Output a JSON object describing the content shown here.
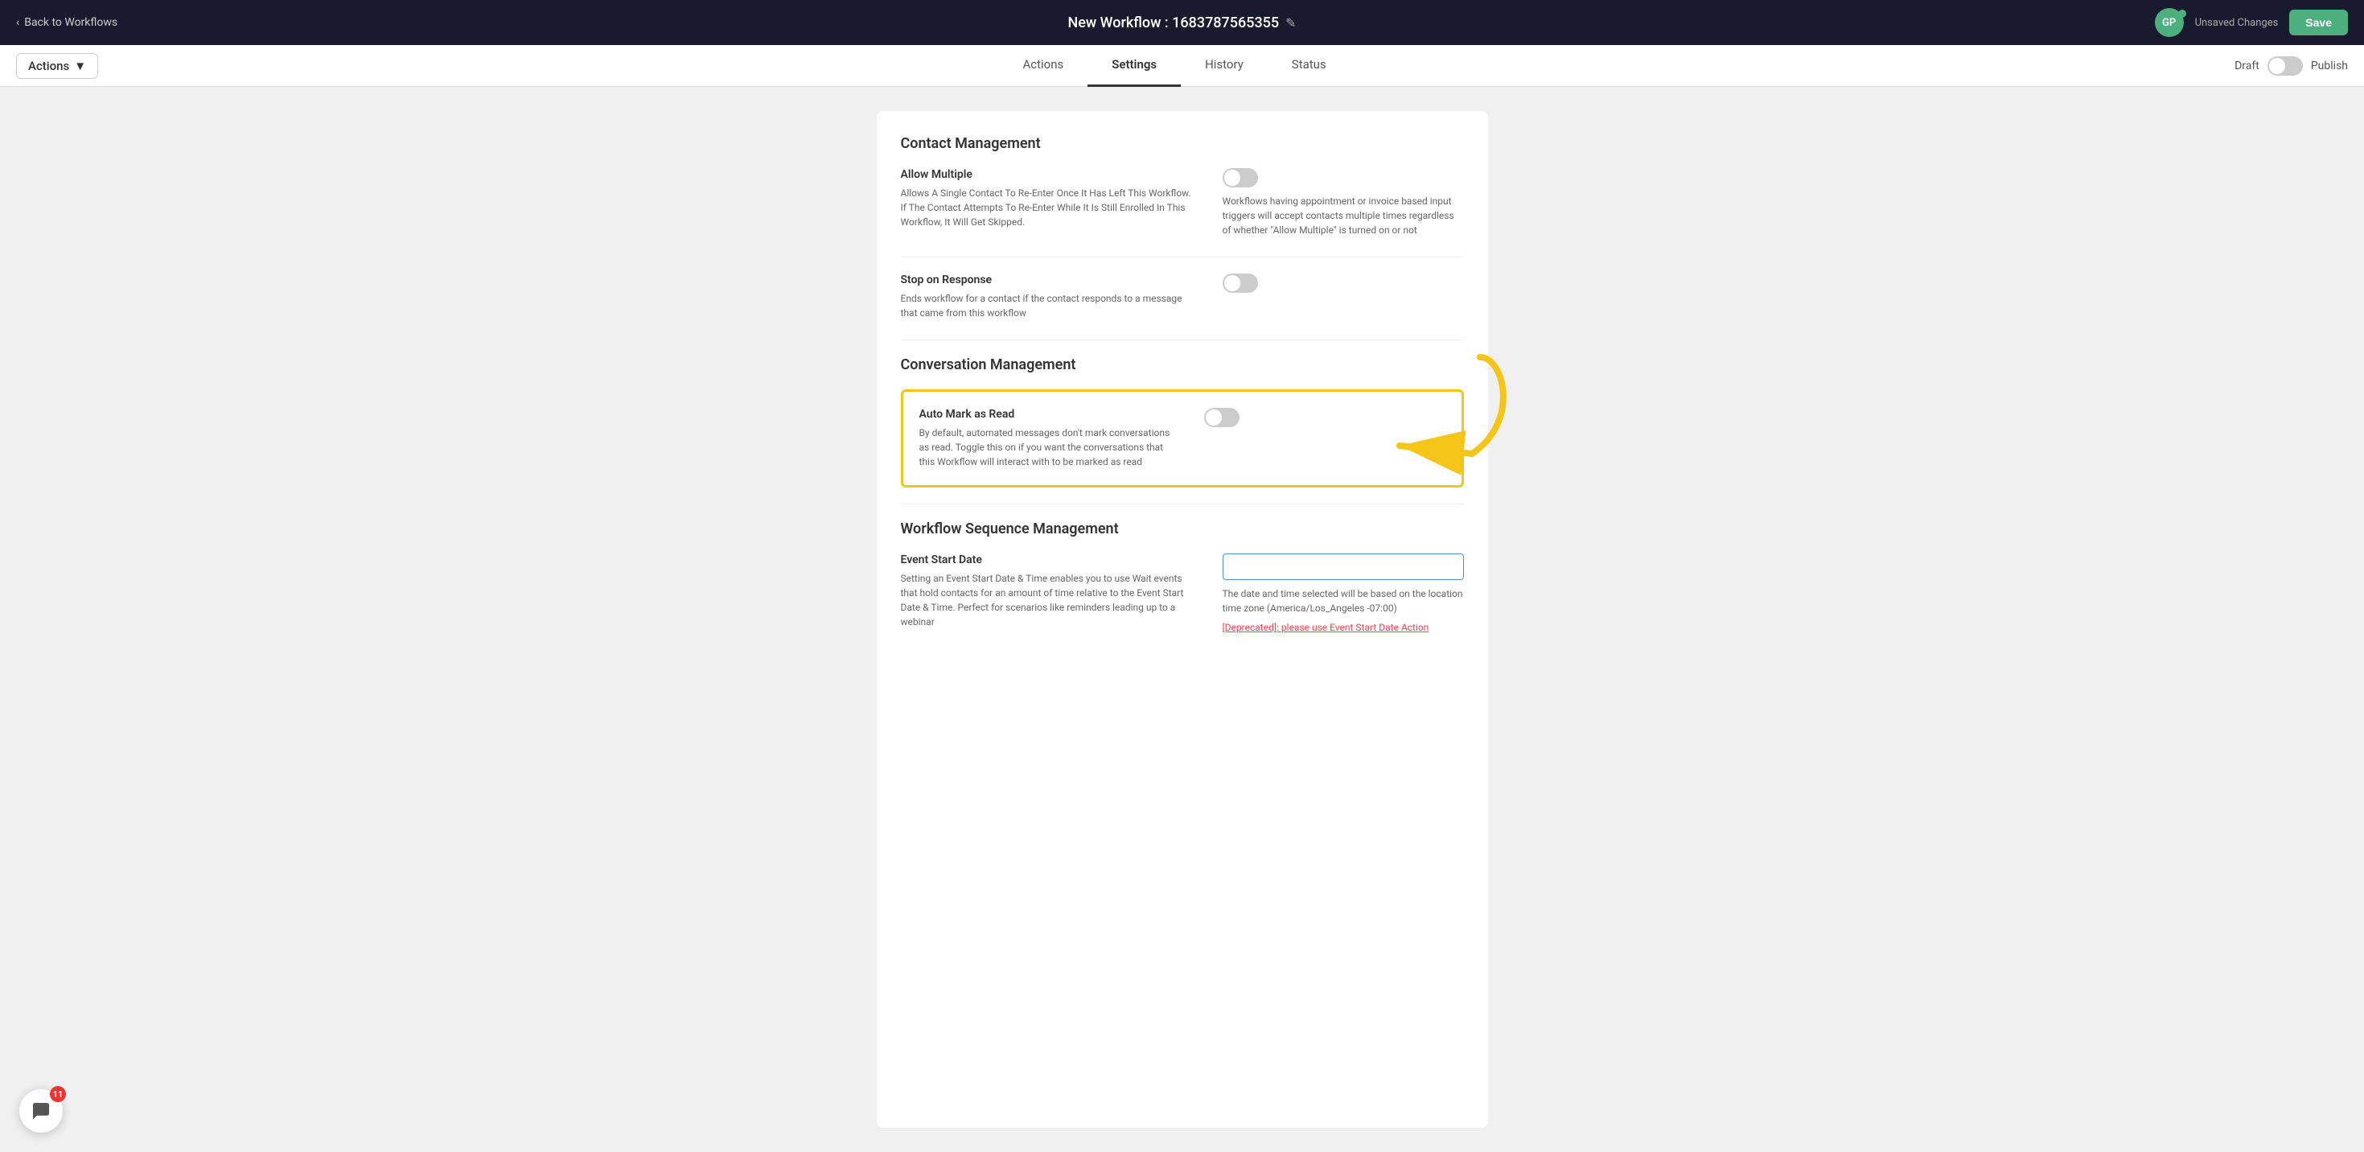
{
  "topNav": {
    "backLabel": "Back to Workflows",
    "workflowTitle": "New Workflow : 1683787565355",
    "avatarInitials": "GP",
    "unsavedLabel": "Unsaved Changes",
    "saveLabel": "Save"
  },
  "secNav": {
    "actionsLabel": "Actions",
    "tabs": [
      {
        "id": "actions",
        "label": "Actions",
        "active": false
      },
      {
        "id": "settings",
        "label": "Settings",
        "active": true
      },
      {
        "id": "history",
        "label": "History",
        "active": false
      },
      {
        "id": "status",
        "label": "Status",
        "active": false
      }
    ],
    "draftLabel": "Draft",
    "publishLabel": "Publish"
  },
  "sections": {
    "contactManagement": {
      "title": "Contact Management",
      "allowMultiple": {
        "label": "Allow Multiple",
        "desc": "Allows A Single Contact To Re-Enter Once It Has Left This Workflow. If The Contact Attempts To Re-Enter While It Is Still Enrolled In This Workflow, It Will Get Skipped.",
        "toggleState": "off",
        "noteText": "Workflows having appointment or invoice based input triggers will accept contacts multiple times regardless of whether \"Allow Multiple\" is turned on or not"
      },
      "stopOnResponse": {
        "label": "Stop on Response",
        "desc": "Ends workflow for a contact if the contact responds to a message that came from this workflow",
        "toggleState": "off"
      }
    },
    "conversationManagement": {
      "title": "Conversation Management",
      "autoMarkAsRead": {
        "label": "Auto Mark as Read",
        "desc": "By default, automated messages don't mark conversations as read. Toggle this on if you want the conversations that this Workflow will interact with to be marked as read",
        "toggleState": "off"
      }
    },
    "workflowSequenceManagement": {
      "title": "Workflow Sequence Management",
      "eventStartDate": {
        "label": "Event Start Date",
        "desc": "Setting an Event Start Date & Time enables you to use Wait events that hold contacts for an amount of time relative to the Event Start Date & Time. Perfect for scenarios like reminders leading up to a webinar",
        "inputValue": "",
        "inputPlaceholder": "",
        "noteText": "The date and time selected will be based on the location time zone (America/Los_Angeles -07:00)",
        "deprecatedText": "[Deprecated]: please use Event Start Date Action"
      }
    }
  },
  "chatWidget": {
    "badgeCount": "11"
  }
}
